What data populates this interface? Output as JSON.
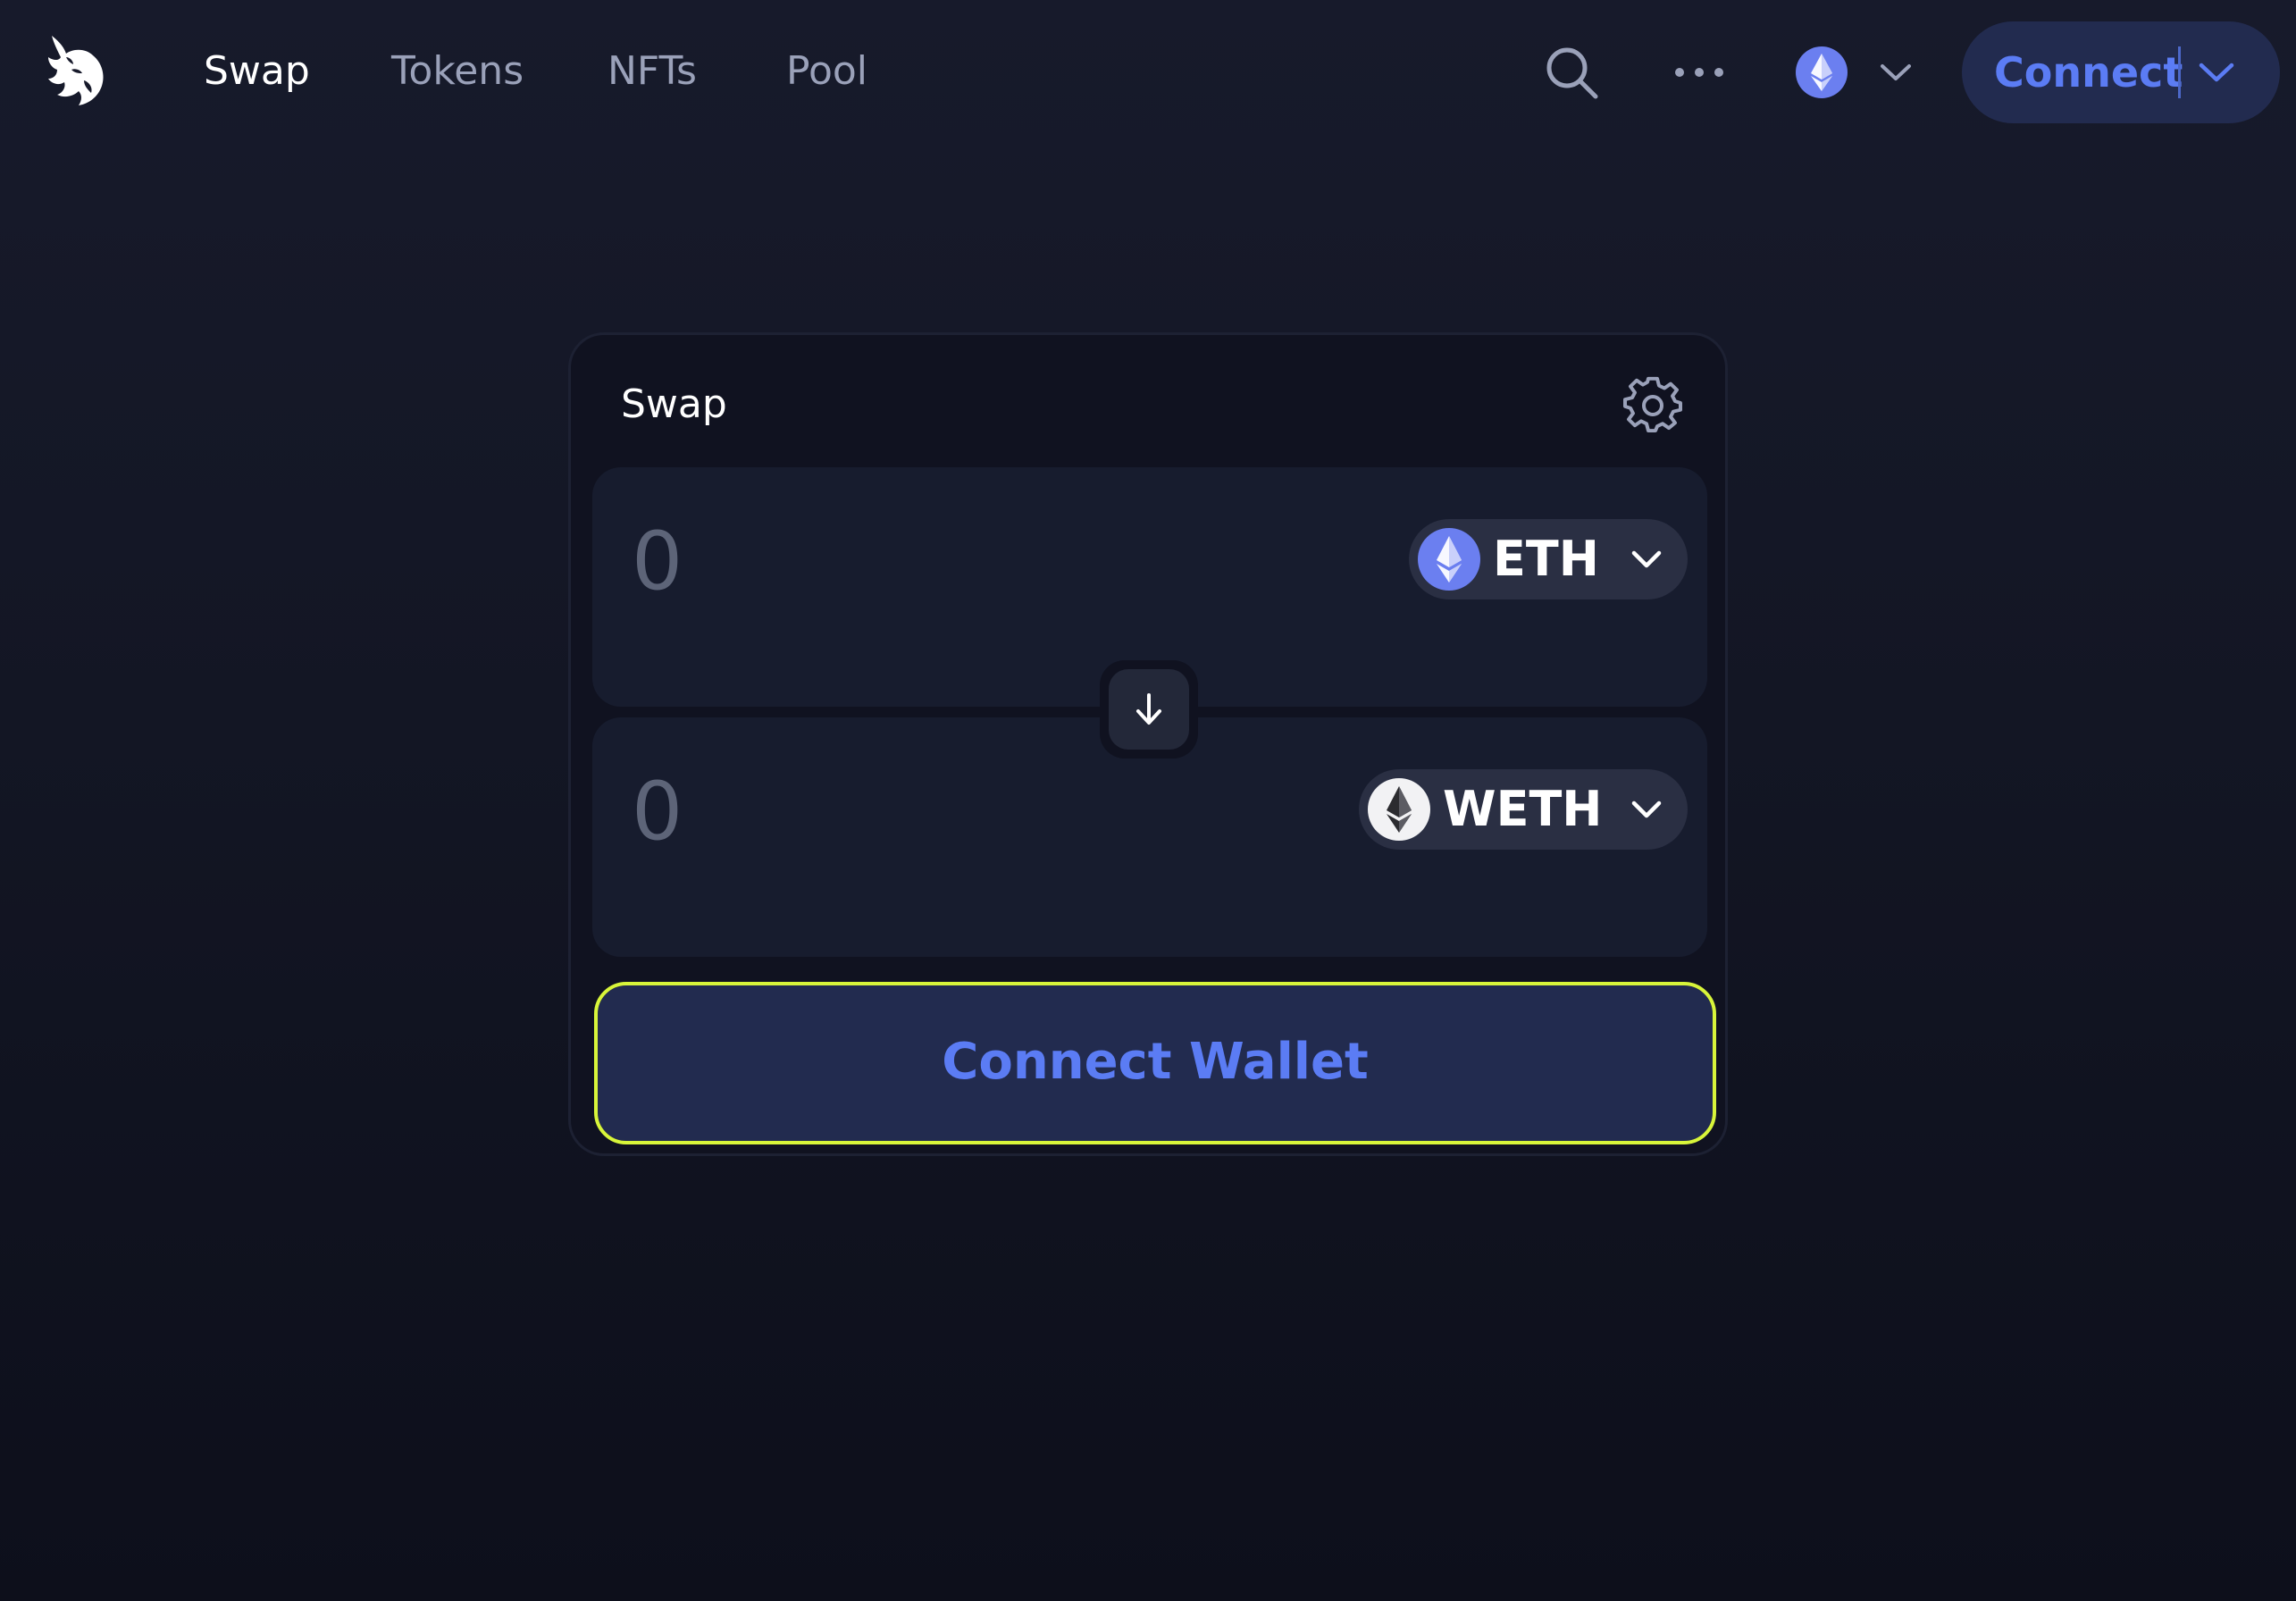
{
  "nav": {
    "links": [
      {
        "label": "Swap",
        "active": true
      },
      {
        "label": "Tokens",
        "active": false
      },
      {
        "label": "NFTs",
        "active": false
      },
      {
        "label": "Pool",
        "active": false
      }
    ],
    "icons": {
      "logo": "uniswap-unicorn-logo",
      "search": "search-icon",
      "more": "more-horizontal-icon",
      "network": "ethereum-icon",
      "network_chevron": "chevron-down-icon"
    },
    "connect_label": "Connect"
  },
  "swap": {
    "title": "Swap",
    "settings_icon": "gear-icon",
    "input": {
      "placeholder": "0",
      "token": "ETH",
      "token_icon": "ethereum-icon"
    },
    "output": {
      "placeholder": "0",
      "token": "WETH",
      "token_icon": "weth-icon"
    },
    "switch_icon": "arrow-down-icon",
    "connect_wallet_label": "Connect Wallet"
  },
  "colors": {
    "background": "#131624",
    "card": "#101220",
    "panel": "#171c2e",
    "accent": "#5b7cf4",
    "accent_bg": "#222b4f",
    "highlight_outline": "#d8f53a",
    "muted_text": "#9aa1b9"
  }
}
